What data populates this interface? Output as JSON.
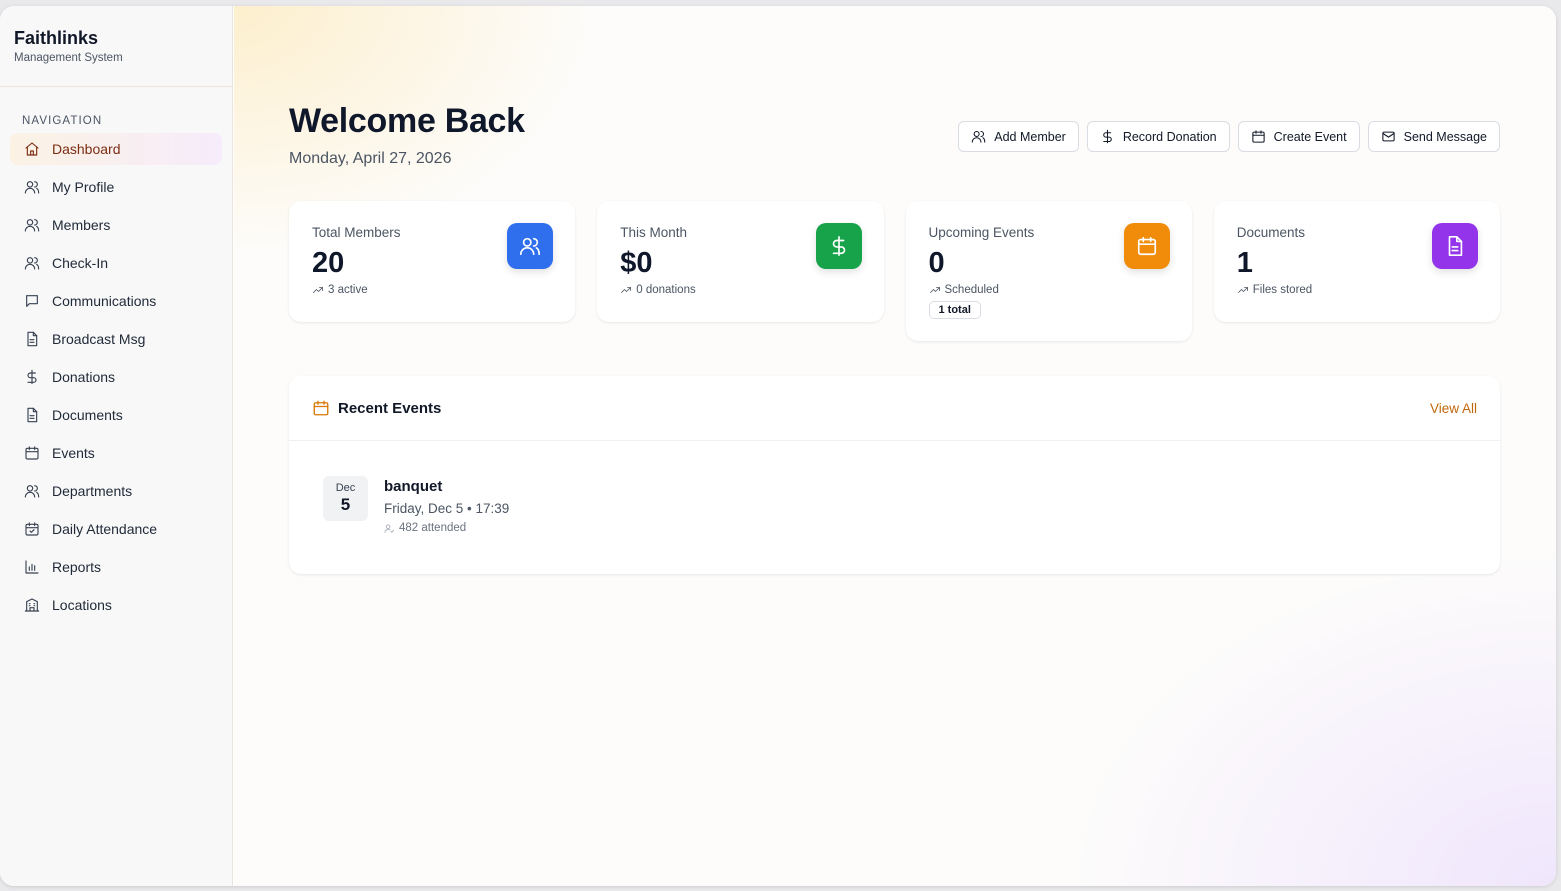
{
  "app": {
    "name": "Faithlinks",
    "subtitle": "Management System"
  },
  "sidebar": {
    "heading": "NAVIGATION",
    "items": [
      {
        "label": "Dashboard",
        "icon": "home-icon",
        "active": true
      },
      {
        "label": "My Profile",
        "icon": "users-icon"
      },
      {
        "label": "Members",
        "icon": "users-icon"
      },
      {
        "label": "Check-In",
        "icon": "users-icon"
      },
      {
        "label": "Communications",
        "icon": "message-icon"
      },
      {
        "label": "Broadcast Msg",
        "icon": "document-icon"
      },
      {
        "label": "Donations",
        "icon": "dollar-icon"
      },
      {
        "label": "Documents",
        "icon": "document-icon"
      },
      {
        "label": "Events",
        "icon": "calendar-icon"
      },
      {
        "label": "Departments",
        "icon": "users-icon"
      },
      {
        "label": "Daily Attendance",
        "icon": "calendar-check-icon"
      },
      {
        "label": "Reports",
        "icon": "bar-chart-icon"
      },
      {
        "label": "Locations",
        "icon": "building-icon"
      }
    ]
  },
  "header": {
    "title": "Welcome Back",
    "date": "Monday, April 27, 2026",
    "actions": [
      {
        "label": "Add Member",
        "icon": "user-plus-icon"
      },
      {
        "label": "Record Donation",
        "icon": "dollar-icon"
      },
      {
        "label": "Create Event",
        "icon": "calendar-icon"
      },
      {
        "label": "Send Message",
        "icon": "mail-icon"
      }
    ]
  },
  "stats": [
    {
      "label": "Total Members",
      "value": "20",
      "sub": "3 active",
      "icon": "users-icon",
      "color": "#2f6fed"
    },
    {
      "label": "This Month",
      "value": "$0",
      "sub": "0 donations",
      "icon": "dollar-icon",
      "color": "#16a34a"
    },
    {
      "label": "Upcoming Events",
      "value": "0",
      "sub": "Scheduled",
      "badge": "1 total",
      "icon": "calendar-icon",
      "color": "#f08c0a"
    },
    {
      "label": "Documents",
      "value": "1",
      "sub": "Files stored",
      "icon": "document-icon",
      "color": "#9333ea"
    }
  ],
  "recent_events": {
    "title": "Recent Events",
    "view_all": "View All",
    "items": [
      {
        "month": "Dec",
        "day": "5",
        "name": "banquet",
        "when": "Friday, Dec 5 • 17:39",
        "attended": "482 attended"
      }
    ]
  }
}
